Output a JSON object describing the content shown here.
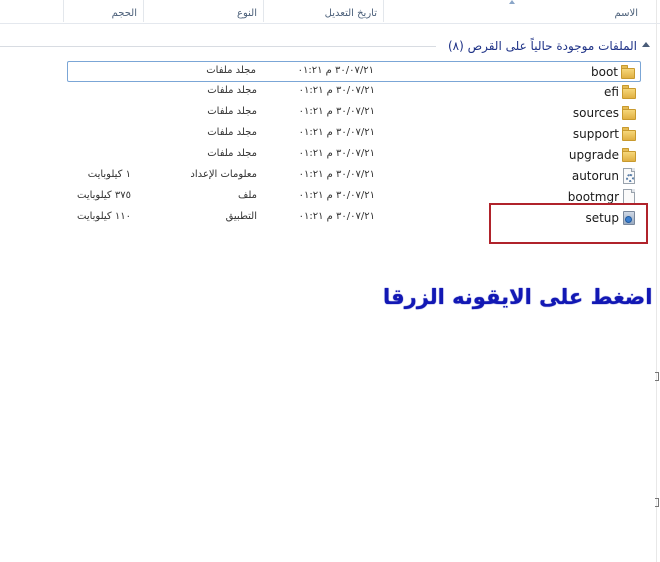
{
  "columns": {
    "name": "الاسم",
    "date_modified": "تاريخ التعديل",
    "type": "النوع",
    "size": "الحجم"
  },
  "group": {
    "title": "الملفات موجودة حالياً على القرص (٨)"
  },
  "files": [
    {
      "name": "boot",
      "date": "٣٠/٠٧/٢١ م ٠١:٢١",
      "type": "مجلد ملفات",
      "size": "",
      "icon": "folder-icon"
    },
    {
      "name": "efi",
      "date": "٣٠/٠٧/٢١ م ٠١:٢١",
      "type": "مجلد ملفات",
      "size": "",
      "icon": "folder-icon"
    },
    {
      "name": "sources",
      "date": "٣٠/٠٧/٢١ م ٠١:٢١",
      "type": "مجلد ملفات",
      "size": "",
      "icon": "folder-icon"
    },
    {
      "name": "support",
      "date": "٣٠/٠٧/٢١ م ٠١:٢١",
      "type": "مجلد ملفات",
      "size": "",
      "icon": "folder-icon"
    },
    {
      "name": "upgrade",
      "date": "٣٠/٠٧/٢١ م ٠١:٢١",
      "type": "مجلد ملفات",
      "size": "",
      "icon": "folder-icon"
    },
    {
      "name": "autorun",
      "date": "٣٠/٠٧/٢١ م ٠١:٢١",
      "type": "معلومات الإعداد",
      "size": "١ كيلوبايت",
      "icon": "settings-file-icon"
    },
    {
      "name": "bootmgr",
      "date": "٣٠/٠٧/٢١ م ٠١:٢١",
      "type": "ملف",
      "size": "٣٧٥ كيلوبايت",
      "icon": "file-icon"
    },
    {
      "name": "setup",
      "date": "٣٠/٠٧/٢١ م ٠١:٢١",
      "type": "التطبيق",
      "size": "١١٠ كيلوبايت",
      "icon": "setup-app-icon"
    }
  ],
  "instruction": "اضغط على الايقونه الزرقا",
  "colors": {
    "highlight_border": "#b0232b",
    "instruction_text": "#1218b4",
    "group_title": "#1e3287"
  }
}
